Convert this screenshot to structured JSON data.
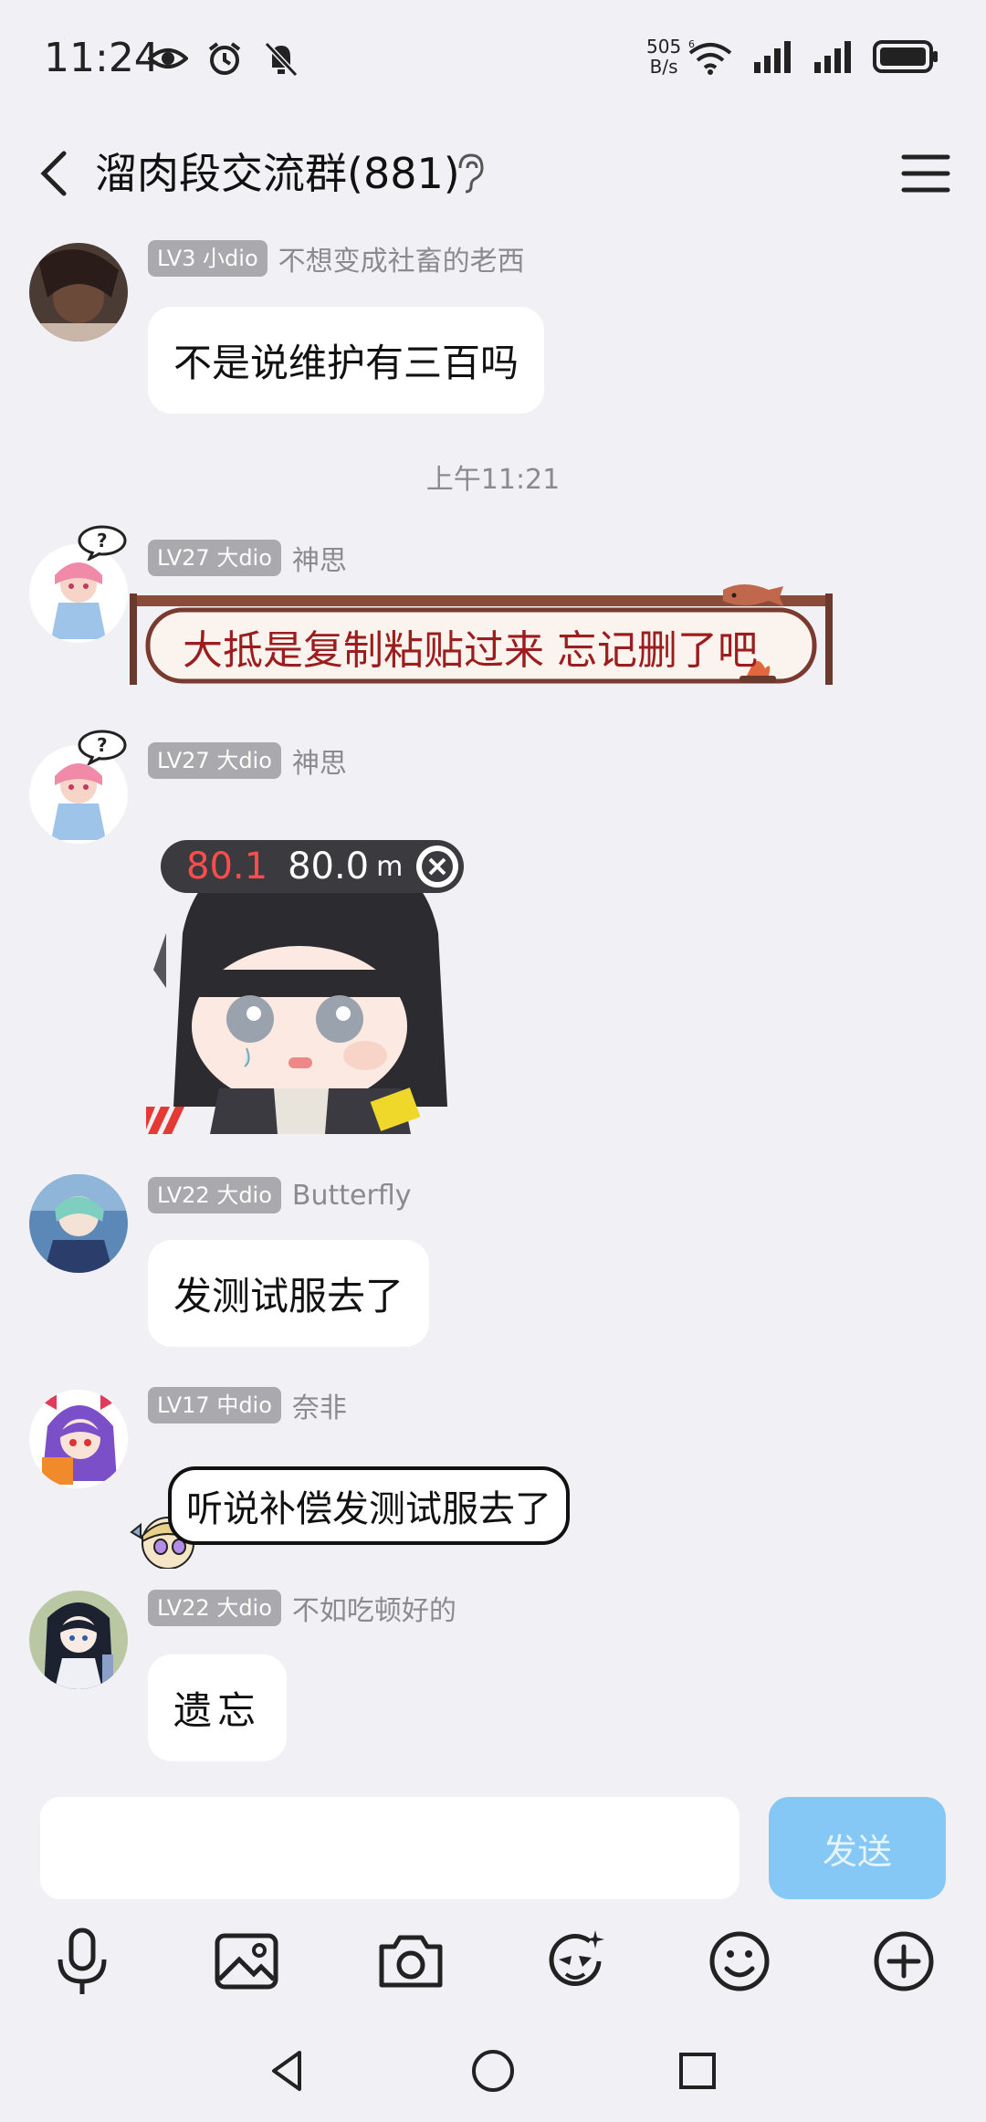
{
  "status": {
    "time": "11:24",
    "net_rate_top": "505",
    "net_rate_bottom": "B/s",
    "icons": [
      "eye-icon",
      "alarm-icon",
      "mute-icon",
      "wifi-6-icon",
      "signal-icon",
      "signal-icon",
      "battery-icon"
    ]
  },
  "header": {
    "title": "溜肉段交流群(881)"
  },
  "messages": [
    {
      "badge": "LV3 小dio",
      "name": "不想变成社畜的老西",
      "text": "不是说维护有三百吗"
    },
    {
      "badge": "LV27 大dio",
      "name": "神思",
      "text": "大抵是复制粘贴过来 忘记删了吧"
    },
    {
      "badge": "LV27 大dio",
      "name": "神思",
      "sticker_red": "80.1",
      "sticker_white": "80.0",
      "sticker_unit": "m"
    },
    {
      "badge": "LV22 大dio",
      "name": "Butterfly",
      "text": "发测试服去了"
    },
    {
      "badge": "LV17 中dio",
      "name": "奈非",
      "text": "听说补偿发测试服去了"
    },
    {
      "badge": "LV22 大dio",
      "name": "不如吃顿好的",
      "text": "遗忘"
    }
  ],
  "timestamp": "上午11:21",
  "input": {
    "placeholder": "",
    "send_label": "发送"
  },
  "toolbar": [
    "microphone-icon",
    "image-icon",
    "camera-icon",
    "sticker-icon",
    "emoji-icon",
    "plus-icon"
  ],
  "colors": {
    "background": "#f1f1f5",
    "send_button": "#86c8f5",
    "badge": "#a9a9ae",
    "scroll_text": "#9c1d1d"
  }
}
